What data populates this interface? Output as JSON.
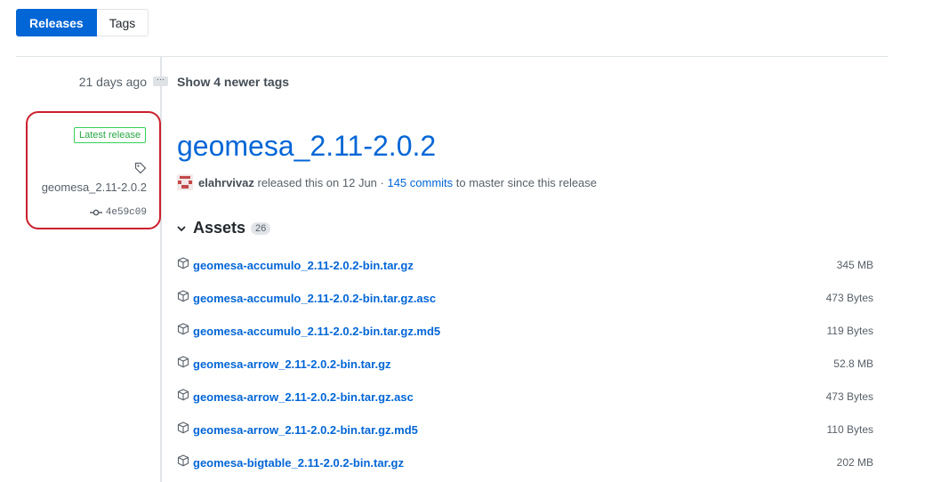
{
  "tabs": {
    "releases": "Releases",
    "tags": "Tags"
  },
  "timeline": {
    "ago": "21 days ago",
    "ellipsis": "···",
    "newer_tags": "Show 4 newer tags"
  },
  "sidebar": {
    "badge": "Latest release",
    "tag_name": "geomesa_2.11-2.0.2",
    "commit_hash": "4e59c09"
  },
  "release": {
    "title": "geomesa_2.11-2.0.2",
    "author": "elahrvivaz",
    "released_text": " released this on 12 Jun · ",
    "commits_link": "145 commits",
    "commits_suffix": " to master since this release"
  },
  "assets": {
    "label": "Assets",
    "count": "26",
    "items": [
      {
        "name": "geomesa-accumulo_2.11-2.0.2-bin.tar.gz",
        "size": "345 MB"
      },
      {
        "name": "geomesa-accumulo_2.11-2.0.2-bin.tar.gz.asc",
        "size": "473 Bytes"
      },
      {
        "name": "geomesa-accumulo_2.11-2.0.2-bin.tar.gz.md5",
        "size": "119 Bytes"
      },
      {
        "name": "geomesa-arrow_2.11-2.0.2-bin.tar.gz",
        "size": "52.8 MB"
      },
      {
        "name": "geomesa-arrow_2.11-2.0.2-bin.tar.gz.asc",
        "size": "473 Bytes"
      },
      {
        "name": "geomesa-arrow_2.11-2.0.2-bin.tar.gz.md5",
        "size": "110 Bytes"
      },
      {
        "name": "geomesa-bigtable_2.11-2.0.2-bin.tar.gz",
        "size": "202 MB"
      }
    ]
  },
  "colors": {
    "link": "#0366d6",
    "accent": "#0366d6",
    "highlight": "#cc1f2c",
    "latest": "#28a745"
  }
}
